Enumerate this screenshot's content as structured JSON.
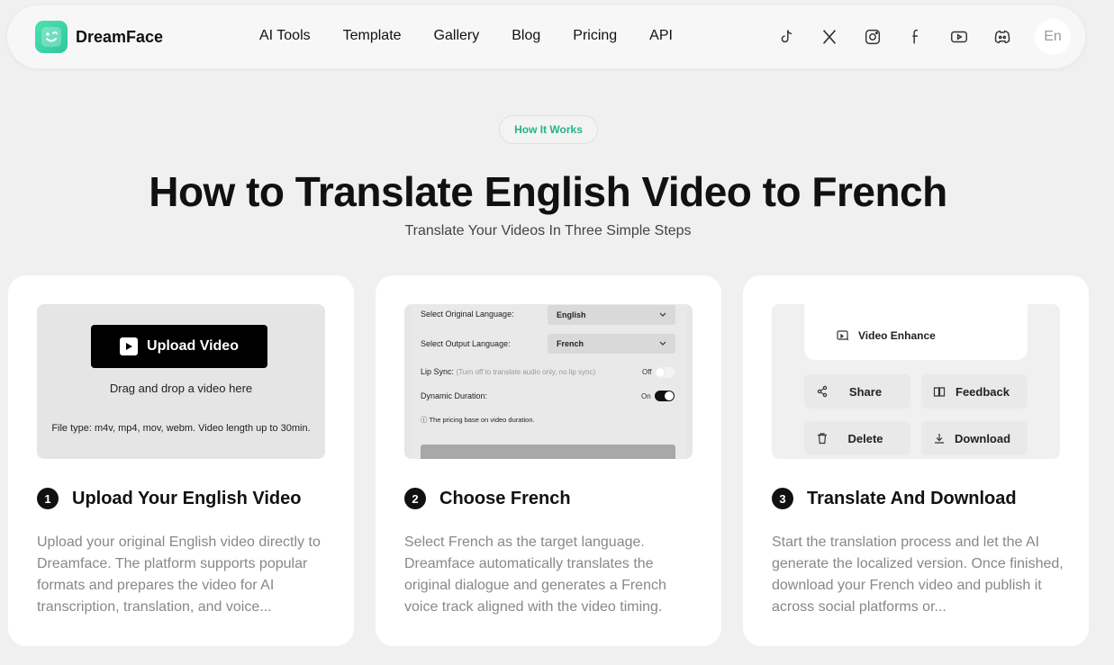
{
  "brand": {
    "name": "DreamFace",
    "accent": "#3ad5a8"
  },
  "nav": {
    "links": [
      "AI Tools",
      "Template",
      "Gallery",
      "Blog",
      "Pricing",
      "API"
    ],
    "social_icons": [
      "tiktok-icon",
      "x-icon",
      "instagram-icon",
      "facebook-icon",
      "youtube-icon",
      "discord-icon"
    ],
    "language": "En"
  },
  "hero": {
    "badge": "How It Works",
    "title": "How to Translate English Video to French",
    "subtitle": "Translate Your Videos In Three Simple Steps"
  },
  "steps": [
    {
      "number": "1",
      "title": "Upload Your English Video",
      "description": "Upload your original English video directly to Dreamface. The platform supports popular formats and prepares the video for AI transcription, translation, and voice...",
      "preview": {
        "button": "Upload Video",
        "drag_text": "Drag and drop a video here",
        "file_type": "File type: m4v, mp4, mov, webm. Video length up to 30min."
      }
    },
    {
      "number": "2",
      "title": "Choose French",
      "description": "Select French as the target language. Dreamface automatically translates the original dialogue and generates a French voice track aligned with the video timing.",
      "preview": {
        "original_label": "Select Original Language:",
        "original_value": "English",
        "output_label": "Select Output Language:",
        "output_value": "French",
        "lip_sync_label": "Lip Sync:",
        "lip_sync_hint": "(Turn off to translate audio only, no lip sync)",
        "lip_sync_state": "Off",
        "dynamic_label": "Dynamic Duration:",
        "dynamic_state": "On",
        "pricing_note": "The pricing base on video duration."
      }
    },
    {
      "number": "3",
      "title": "Translate And Download",
      "description": "Start the translation process and let the AI generate the localized version. Once finished, download your French video and publish it across social platforms or...",
      "preview": {
        "enhance": "Video Enhance",
        "share": "Share",
        "feedback": "Feedback",
        "delete": "Delete",
        "download": "Download"
      }
    }
  ]
}
